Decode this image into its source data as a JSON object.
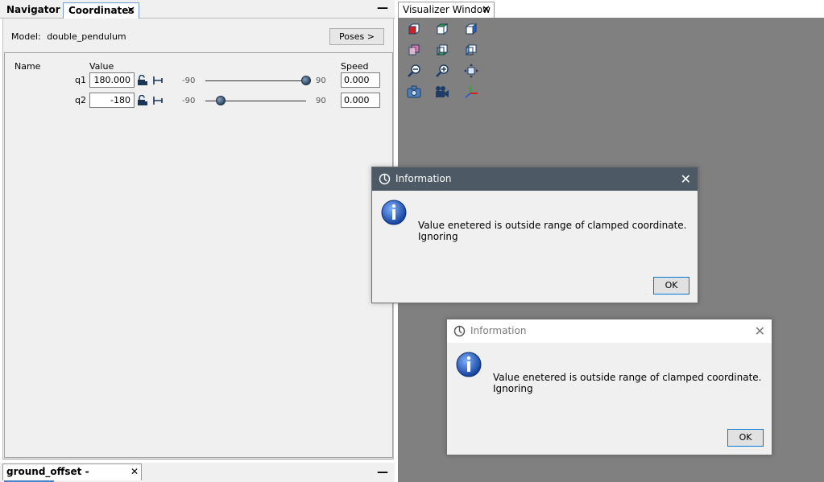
{
  "left_tabs": {
    "navigator_label": "Navigator",
    "coordinates_label": "Coordinates",
    "close_glyph": "✕",
    "minimize_glyph": "—"
  },
  "coordinates_panel": {
    "model_label": "Model:",
    "model_name": "double_pendulum",
    "poses_button": "Poses >",
    "headers": {
      "name": "Name",
      "value": "Value",
      "speed": "Speed"
    },
    "rows": [
      {
        "name": "q1",
        "value": "180.000",
        "min": "-90",
        "max": "90",
        "slider_fraction": 1.0,
        "speed": "0.000",
        "lock_icon": "lock-icon",
        "clamp_icon": "clamp-icon"
      },
      {
        "name": "q2",
        "value": "-180",
        "min": "-90",
        "max": "90",
        "slider_fraction": 0.15,
        "speed": "0.000",
        "lock_icon": "lock-icon",
        "clamp_icon": "clamp-icon"
      }
    ]
  },
  "properties_tab": {
    "label": "ground_offset - Properties",
    "close_glyph": "✕",
    "minimize_glyph": "—"
  },
  "visualizer": {
    "tab_label": "Visualizer Window",
    "close_glyph": "✕",
    "background": "#808080",
    "tools": [
      "front-view-icon",
      "top-view-icon",
      "right-view-icon",
      "back-view-icon",
      "bottom-view-icon",
      "left-view-icon",
      "zoom-out-icon",
      "zoom-in-icon",
      "fit-view-icon",
      "snapshot-icon",
      "record-icon",
      "axes-icon"
    ]
  },
  "dialogs": [
    {
      "title": "Information",
      "message": "Value enetered is outside range of clamped coordinate. Ignoring",
      "ok_label": "OK",
      "close_glyph": "✕",
      "state": "active"
    },
    {
      "title": "Information",
      "message": "Value enetered is outside range of clamped coordinate. Ignoring",
      "ok_label": "OK",
      "close_glyph": "✕",
      "state": "inactive"
    }
  ],
  "colors": {
    "panel_bg": "#f0f0f0",
    "active_title": "#4d5a66",
    "accent": "#0078d7",
    "info_blue": "#1f5fbf"
  }
}
